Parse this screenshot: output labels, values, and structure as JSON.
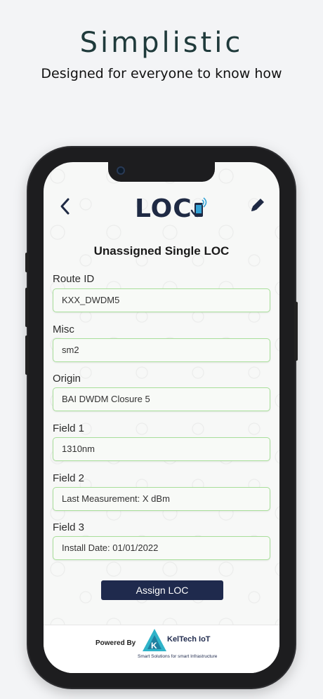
{
  "hero": {
    "title": "Simplistic",
    "subtitle": "Designed for everyone to know how"
  },
  "app": {
    "logo_text": "LOC",
    "page_title": "Unassigned Single LOC",
    "fields": [
      {
        "label": "Route ID",
        "value": "KXX_DWDM5"
      },
      {
        "label": "Misc",
        "value": "sm2"
      },
      {
        "label": "Origin",
        "value": "BAI DWDM Closure 5"
      },
      {
        "label": "Field 1",
        "value": "1310nm"
      },
      {
        "label": "Field 2",
        "value": "Last Measurement: X dBm"
      },
      {
        "label": "Field 3",
        "value": "Install Date: 01/01/2022"
      }
    ],
    "assign_button": "Assign LOC",
    "footer": {
      "powered_by": "Powered By",
      "company": "KelTech IoT",
      "tagline": "Smart Solutions for smart Infrastructure"
    }
  },
  "colors": {
    "accent": "#1f2a4d",
    "field_border": "#a8df9a",
    "heading": "#1f3a3b"
  },
  "icons": [
    "back-chevron-icon",
    "edit-pencil-icon",
    "logo-phone-icon",
    "keltech-logo-icon"
  ]
}
